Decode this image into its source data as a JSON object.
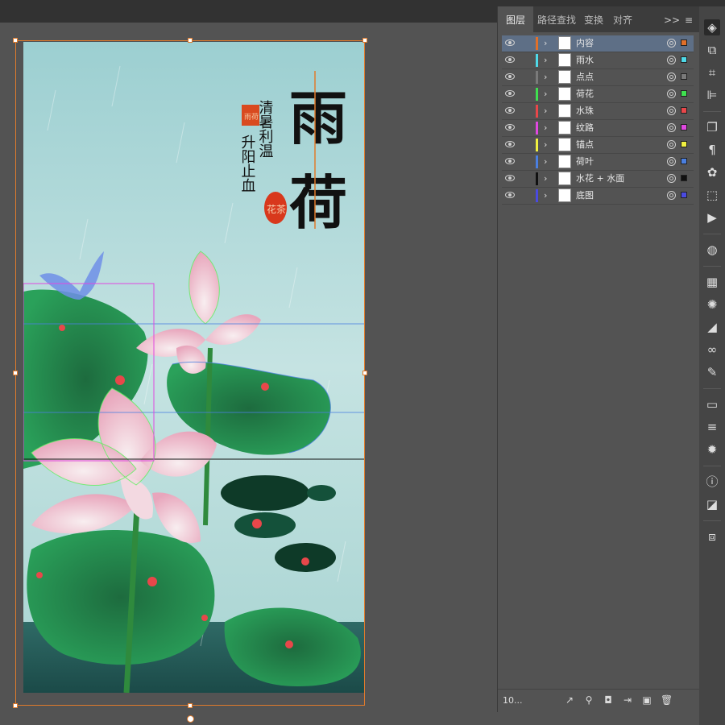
{
  "panel": {
    "tabs": [
      "图层",
      "路径查找",
      "变换",
      "对齐"
    ],
    "overflow_label": ">>",
    "menu_label": "≡",
    "layer_count": "10...",
    "layers": [
      {
        "name": "内容",
        "color": "#e0702a",
        "selected": true
      },
      {
        "name": "雨水",
        "color": "#4fd9e8",
        "selected": false
      },
      {
        "name": "点点",
        "color": "#7a7a7a",
        "selected": false
      },
      {
        "name": "荷花",
        "color": "#3fe04f",
        "selected": false
      },
      {
        "name": "水珠",
        "color": "#e8474a",
        "selected": false
      },
      {
        "name": "纹路",
        "color": "#e048e0",
        "selected": false
      },
      {
        "name": "锚点",
        "color": "#f0f040",
        "selected": false
      },
      {
        "name": "荷叶",
        "color": "#4a7fe0",
        "selected": false
      },
      {
        "name": "水花 + 水面",
        "color": "#111111",
        "selected": false
      },
      {
        "name": "底图",
        "color": "#4a4ae0",
        "selected": false
      }
    ]
  },
  "artwork": {
    "title_char_1": "雨",
    "title_char_2": "荷",
    "poem_col_1": "清暑利温",
    "poem_col_2": "升阳止血",
    "seal_text": "花茶",
    "square_seal_text": "雨荷"
  }
}
